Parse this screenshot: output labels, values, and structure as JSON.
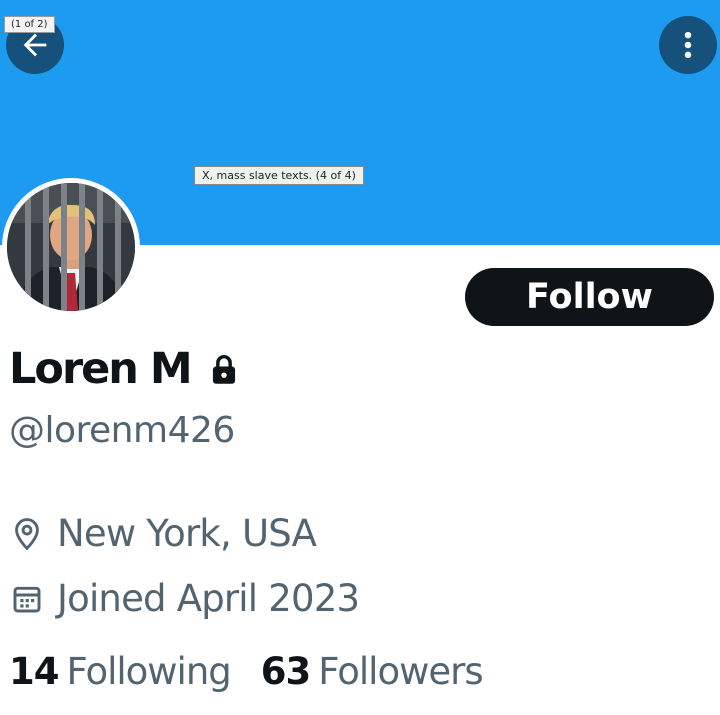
{
  "overlay": {
    "page_indicator": "(1 of 2)",
    "caption": "X, mass slave texts.  (4 of 4)"
  },
  "header": {
    "banner_color": "#1d9bf0",
    "back_icon": "arrow-left-icon",
    "more_icon": "more-vertical-icon"
  },
  "profile": {
    "avatar_icon": "profile-photo",
    "follow_label": "Follow",
    "name": "Loren M",
    "protected_icon": "lock-icon",
    "handle": "@lorenm426",
    "location": "New York, USA",
    "location_icon": "location-pin-icon",
    "joined": "Joined April 2023",
    "joined_icon": "calendar-icon"
  },
  "stats": {
    "following_count": "14",
    "following_label": "Following",
    "followers_count": "63",
    "followers_label": "Followers"
  },
  "colors": {
    "primary_text": "#0f1419",
    "secondary_text": "#536471",
    "follow_bg": "#0f1419"
  }
}
